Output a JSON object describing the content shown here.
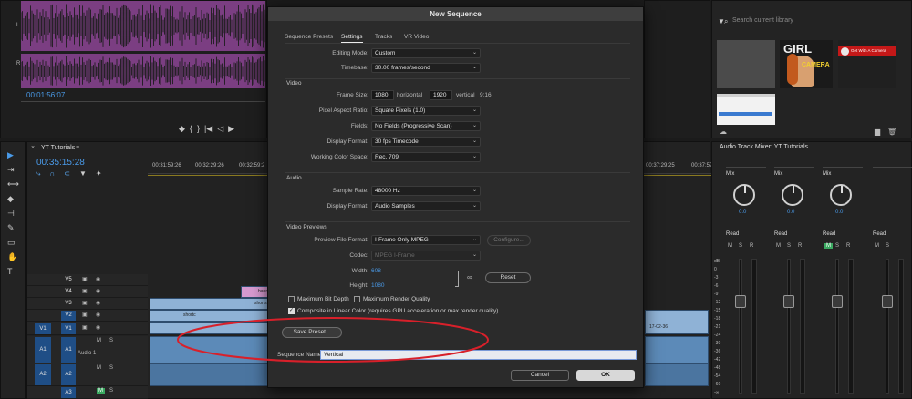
{
  "source_monitor": {
    "timecode": "00:01:56:07",
    "channel_labels": [
      "L",
      "R"
    ],
    "transport_glyphs": [
      "◆",
      "{",
      "}",
      "|◀",
      "◁",
      "▶",
      "▷",
      "▶|"
    ]
  },
  "dialog": {
    "title": "New Sequence",
    "tabs": [
      "Sequence Presets",
      "Settings",
      "Tracks",
      "VR Video"
    ],
    "editing_mode": {
      "label": "Editing Mode:",
      "value": "Custom"
    },
    "timebase": {
      "label": "Timebase:",
      "value": "30.00  frames/second"
    },
    "video_section": "Video",
    "frame_size": {
      "label": "Frame Size:",
      "h_value": "1080",
      "h_label": "horizontal",
      "v_value": "1920",
      "v_label": "vertical",
      "ratio": "9:16"
    },
    "pixel_aspect": {
      "label": "Pixel Aspect Ratio:",
      "value": "Square Pixels (1.0)"
    },
    "fields": {
      "label": "Fields:",
      "value": "No Fields (Progressive Scan)"
    },
    "display_format_video": {
      "label": "Display Format:",
      "value": "30 fps Timecode"
    },
    "working_color": {
      "label": "Working Color Space:",
      "value": "Rec. 709"
    },
    "audio_section": "Audio",
    "sample_rate": {
      "label": "Sample Rate:",
      "value": "48000 Hz"
    },
    "display_format_audio": {
      "label": "Display Format:",
      "value": "Audio Samples"
    },
    "previews_section": "Video Previews",
    "preview_format": {
      "label": "Preview File Format:",
      "value": "I-Frame Only MPEG"
    },
    "configure_label": "Configure...",
    "codec": {
      "label": "Codec:",
      "value": "MPEG I-Frame"
    },
    "width": {
      "label": "Width:",
      "value": "608"
    },
    "height": {
      "label": "Height:",
      "value": "1080"
    },
    "reset_label": "Reset",
    "max_bit_depth": {
      "label": "Maximum Bit Depth",
      "checked": false
    },
    "max_render_quality": {
      "label": "Maximum Render Quality",
      "checked": false
    },
    "composite_linear": {
      "label": "Composite in Linear Color (requires GPU acceleration or max render quality)",
      "checked": true
    },
    "save_preset_label": "Save Preset...",
    "sequence_name_label": "Sequence Name:",
    "sequence_name_value": "Vertical",
    "cancel_label": "Cancel",
    "ok_label": "OK"
  },
  "timeline": {
    "sequence_tab": "YT Tutorials",
    "timecode": "00:35:15:28",
    "ruler_ticks": [
      "00:31:59:26",
      "00:32:29:26",
      "00:32:59:2",
      "00:37:29:25",
      "00:37:59"
    ],
    "tracks": [
      {
        "id": "V5",
        "source": ""
      },
      {
        "id": "V4",
        "source": ""
      },
      {
        "id": "V3",
        "source": ""
      },
      {
        "id": "V2",
        "source": ""
      },
      {
        "id": "V1",
        "source": "V1"
      },
      {
        "id": "A1",
        "source": "A1",
        "name": "Audio 1"
      },
      {
        "id": "A2",
        "source": "A2"
      },
      {
        "id": "A3",
        "source": ""
      }
    ],
    "track_buttons": [
      "M",
      "S"
    ],
    "clip_labels": [
      "banne",
      "shorts",
      "shortc",
      "17-02-36"
    ]
  },
  "library": {
    "search_placeholder": "Search current library",
    "thumb_text_girl": "GIRL",
    "thumb_text_camera": "CAMERA",
    "thumb_text_red": "Get With A Camera"
  },
  "mixer": {
    "title": "Audio Track Mixer: YT Tutorials",
    "channels": [
      {
        "mix": "Mix",
        "pan": "0.0",
        "auto": "Read",
        "m": "M",
        "s": "S",
        "r": "R"
      },
      {
        "mix": "Mix",
        "pan": "0.0",
        "auto": "Read",
        "m": "M",
        "s": "S",
        "r": "R"
      },
      {
        "mix": "Mix",
        "pan": "0.0",
        "auto": "Read",
        "m": "M",
        "s": "S",
        "r": "R"
      },
      {
        "mix": "",
        "pan": "",
        "auto": "Read",
        "m": "M",
        "s": "S",
        "r": ""
      }
    ],
    "db_scale": [
      "dB",
      "0",
      "-3",
      "-6",
      "-9",
      "-12",
      "-15",
      "-18",
      "-21",
      "-24",
      "-30",
      "-36",
      "-42",
      "-48",
      "-54",
      "-60",
      "-∞"
    ],
    "meter_scale": [
      "6",
      "0",
      "-6",
      "-12",
      "-18",
      "-24",
      "-30",
      "-36",
      "-42",
      "-48",
      "-54",
      "-60",
      "-66",
      "-72",
      "-78",
      "-84",
      "-90",
      "-96"
    ]
  },
  "colors": {
    "annotation": "#d8202a",
    "accent_blue": "#4a9ae8",
    "clip_blue": "#8fb2d6",
    "clip_pink": "#d69ad0",
    "audio_purple": "#7b3e82",
    "track_blue": "#1f4e86"
  }
}
